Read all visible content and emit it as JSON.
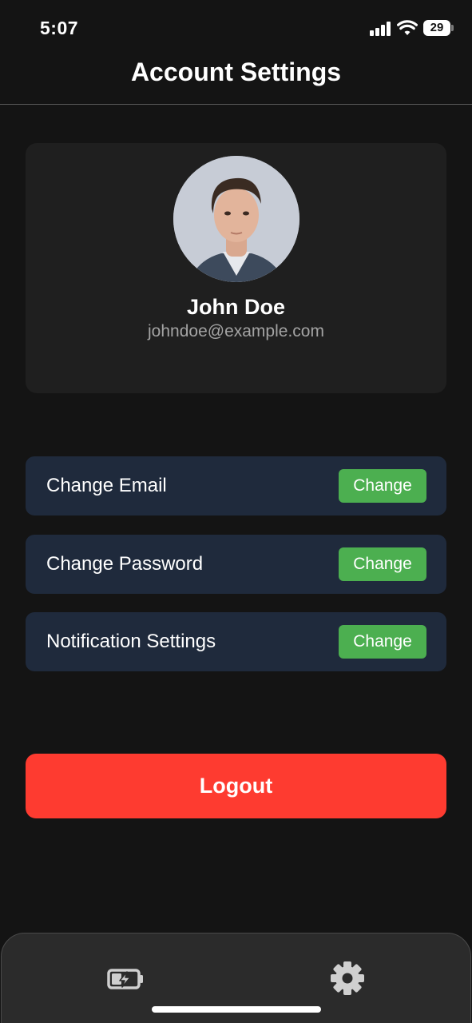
{
  "status_bar": {
    "time": "5:07",
    "battery_level": "29"
  },
  "header": {
    "title": "Account Settings"
  },
  "profile": {
    "name": "John Doe",
    "email": "johndoe@example.com"
  },
  "settings": [
    {
      "label": "Change Email",
      "action": "Change"
    },
    {
      "label": "Change Password",
      "action": "Change"
    },
    {
      "label": "Notification Settings",
      "action": "Change"
    }
  ],
  "logout_label": "Logout",
  "tab_bar": {
    "items": [
      {
        "icon": "battery-charging-icon"
      },
      {
        "icon": "gear-icon"
      }
    ]
  },
  "colors": {
    "background": "#141414",
    "card": "#1f1f1f",
    "row": "#1f2a3c",
    "accent_green": "#4caf50",
    "danger_red": "#fe3b30"
  }
}
